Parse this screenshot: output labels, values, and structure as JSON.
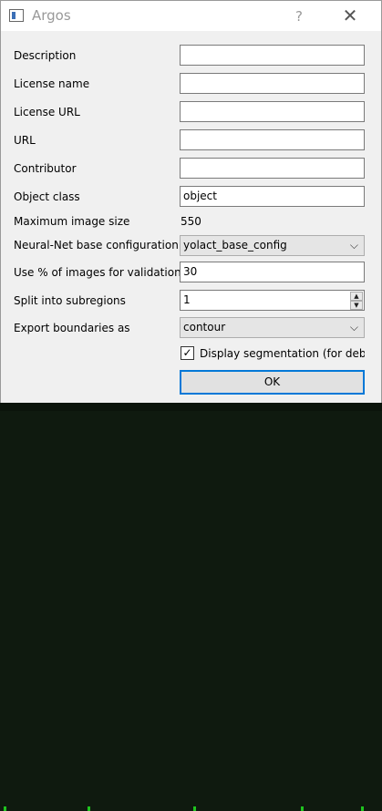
{
  "window": {
    "title": "Argos",
    "help_label": "?",
    "close_label": "✕"
  },
  "form": {
    "description": {
      "label": "Description",
      "value": ""
    },
    "license_name": {
      "label": "License name",
      "value": ""
    },
    "license_url": {
      "label": "License URL",
      "value": ""
    },
    "url": {
      "label": "URL",
      "value": ""
    },
    "contributor": {
      "label": "Contributor",
      "value": ""
    },
    "object_class": {
      "label": "Object class",
      "value": "object"
    },
    "max_image_size": {
      "label": "Maximum image size",
      "value": "550"
    },
    "base_config": {
      "label": "Neural-Net base configuration",
      "value": "yolact_base_config"
    },
    "validation_pct": {
      "label": "Use % of images for validation",
      "value": "30"
    },
    "subregions": {
      "label": "Split into subregions",
      "value": "1"
    },
    "export_boundaries": {
      "label": "Export boundaries as",
      "value": "contour"
    },
    "display_segmentation": {
      "label": "Display segmentation (for debugging)",
      "checked": true
    }
  },
  "ok_label": "OK",
  "icons": {
    "app": "window-app-icon",
    "dropdown": "chevron-down-icon",
    "spin_up": "spin-up-icon",
    "spin_down": "spin-down-icon",
    "check": "checkmark-icon"
  }
}
